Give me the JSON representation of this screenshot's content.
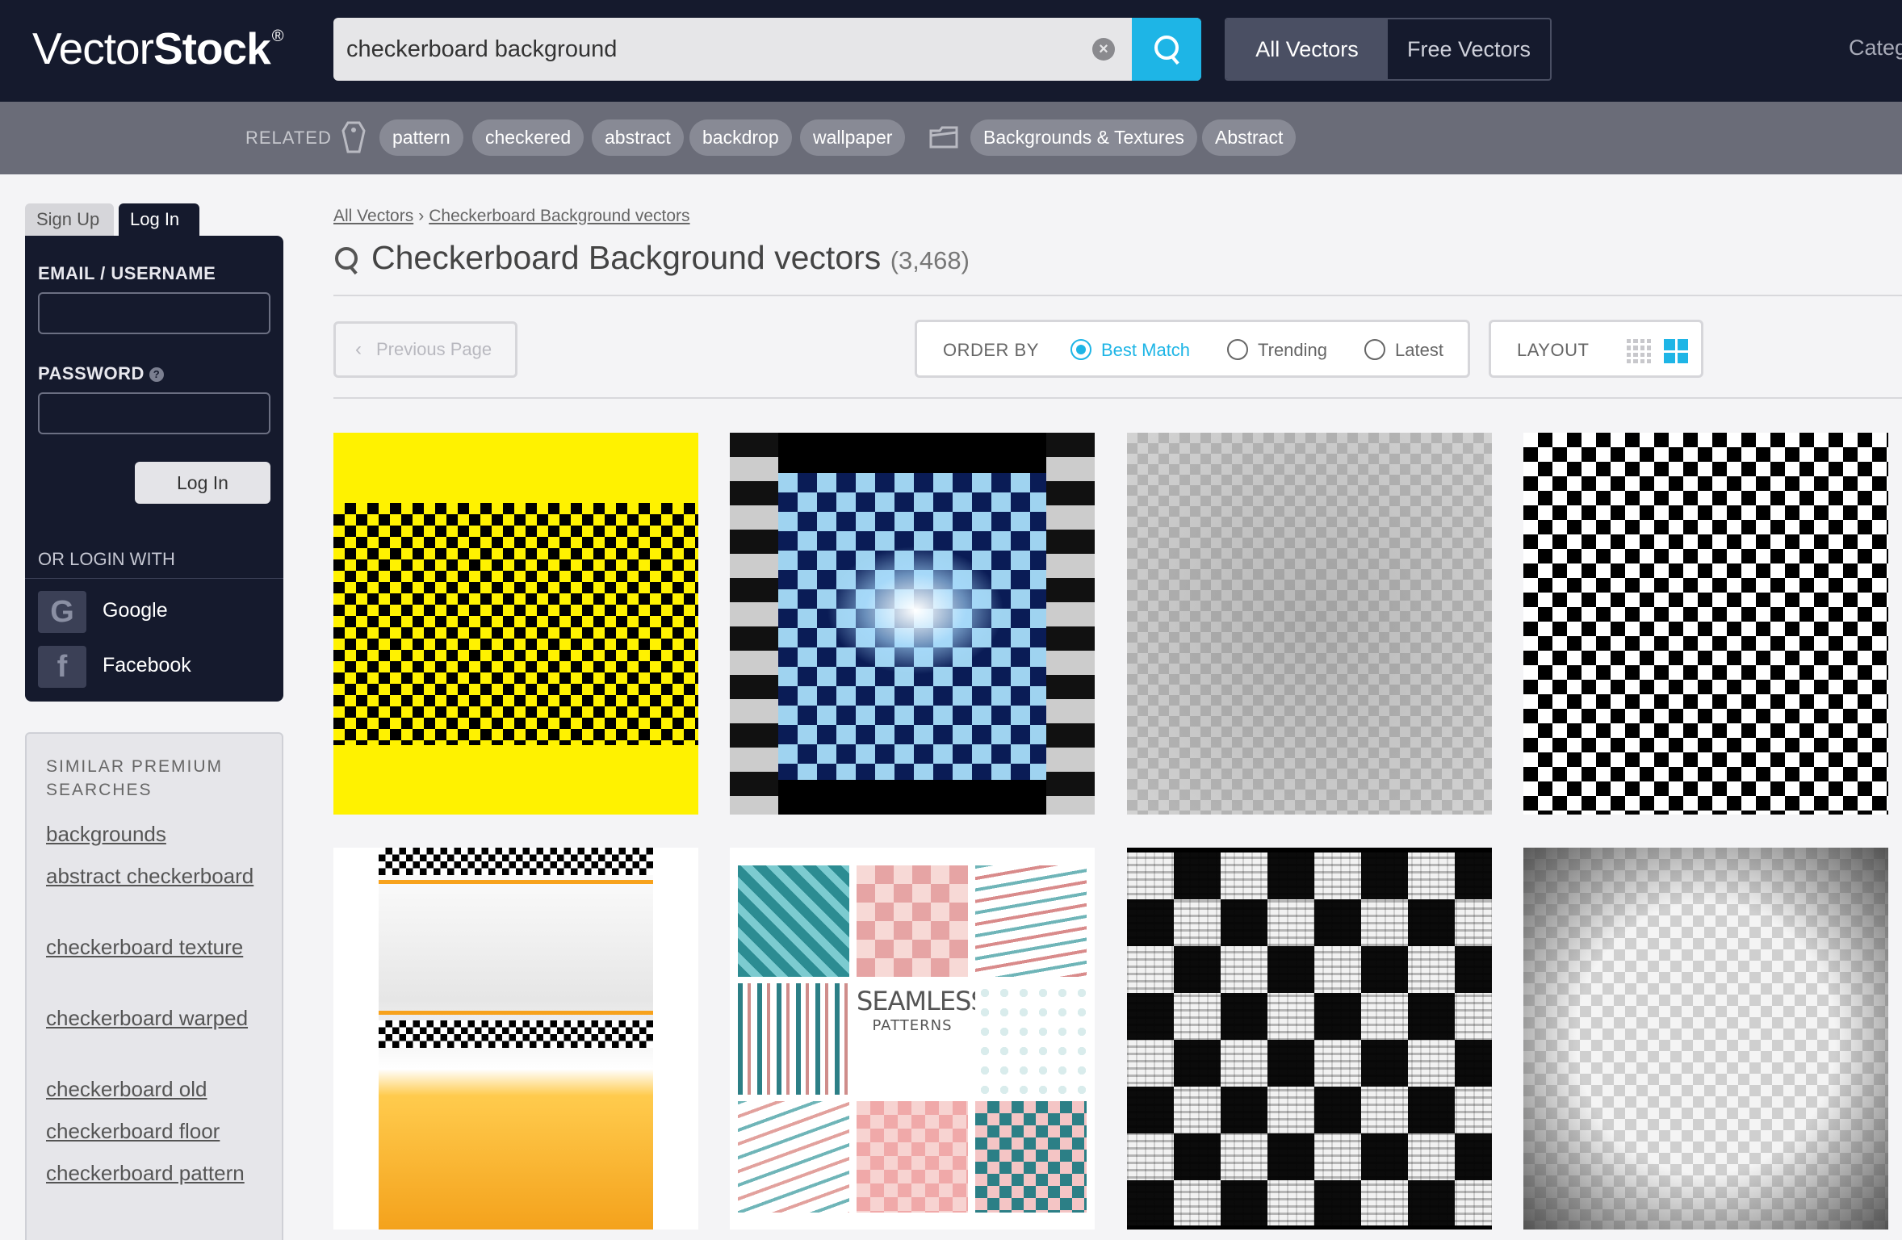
{
  "header": {
    "logo_light": "Vector",
    "logo_bold": "Stock",
    "logo_reg": "®",
    "search_value": "checkerboard background",
    "clear_symbol": "×",
    "tabs": {
      "all": "All Vectors",
      "free": "Free Vectors"
    },
    "categories_partial": "Categ"
  },
  "related": {
    "label": "RELATED",
    "tags": [
      "pattern",
      "checkered",
      "abstract",
      "backdrop",
      "wallpaper"
    ],
    "categories": [
      "Backgrounds & Textures",
      "Abstract"
    ],
    "icons": {
      "tag": "tag-icon",
      "folder": "folder-icon"
    }
  },
  "auth": {
    "tab_signup": "Sign Up",
    "tab_login": "Log In",
    "email_label": "EMAIL / USERNAME",
    "password_label": "PASSWORD",
    "info_symbol": "?",
    "login_button": "Log In",
    "or_login_with": "OR LOGIN WITH",
    "google": "Google",
    "facebook": "Facebook",
    "google_glyph": "G",
    "facebook_glyph": "f"
  },
  "similar": {
    "title": "SIMILAR PREMIUM SEARCHES",
    "links": [
      "backgrounds",
      "abstract checkerboard",
      "checkerboard texture",
      "checkerboard warped",
      "checkerboard old",
      "checkerboard floor",
      "checkerboard pattern"
    ]
  },
  "main": {
    "breadcrumb": {
      "root": "All Vectors",
      "separator": "›",
      "current": "Checkerboard Background vectors"
    },
    "title": "Checkerboard Background vectors",
    "count": "(3,468)",
    "prev_page": "Previous Page",
    "prev_chevron": "‹",
    "order_by": {
      "label": "ORDER BY",
      "options": [
        "Best Match",
        "Trending",
        "Latest"
      ],
      "selected": "Best Match"
    },
    "layout": {
      "label": "LAYOUT",
      "selected": "large-grid"
    },
    "thumbnail_text": {
      "seamless": "SEAMLESS",
      "patterns": "PATTERNS"
    }
  },
  "colors": {
    "accent": "#1eb5e6",
    "header_bg": "#151a2d",
    "related_bg": "#6a6c78"
  }
}
